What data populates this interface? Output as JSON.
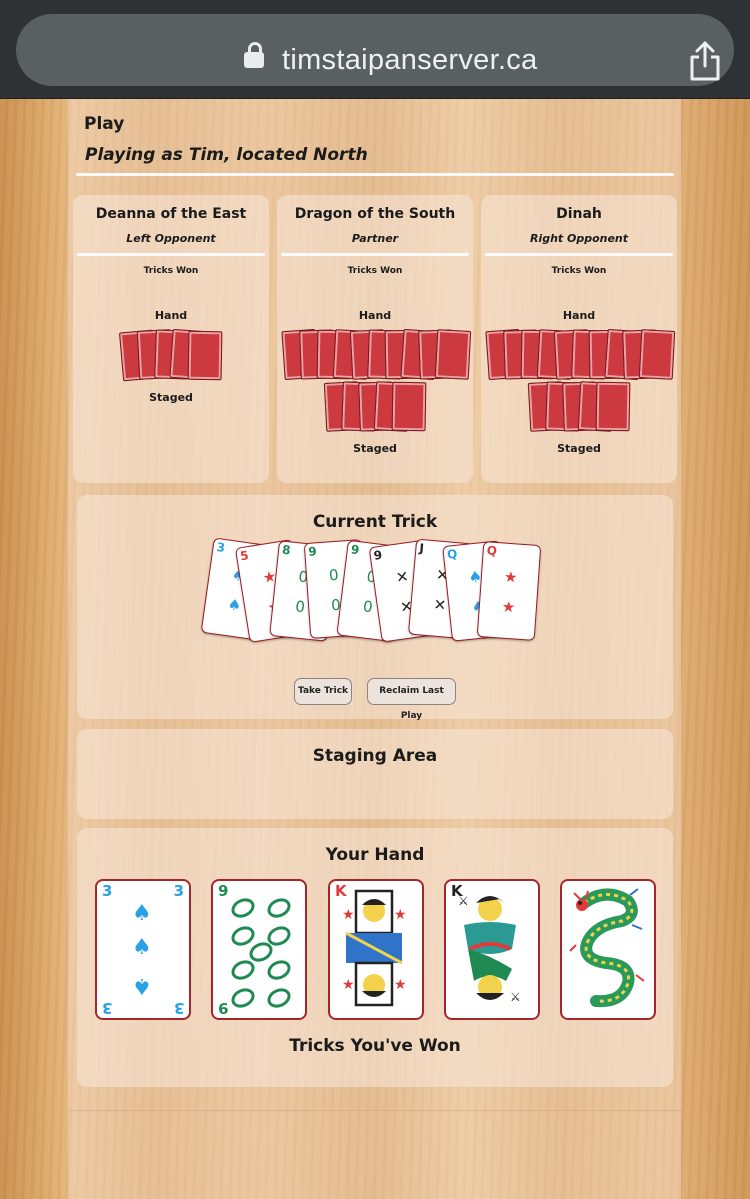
{
  "browser": {
    "url": "timstaipanserver.ca"
  },
  "play": {
    "title": "Play",
    "subtitle": "Playing as Tim, located North"
  },
  "labels": {
    "tricks_won": "Tricks Won",
    "hand": "Hand",
    "staged": "Staged"
  },
  "players": [
    {
      "name": "Deanna of the East",
      "role": "Left Opponent",
      "hand_count": 5,
      "staged_count": 0
    },
    {
      "name": "Dragon of the South",
      "role": "Partner",
      "hand_count": 14,
      "staged_count": 5
    },
    {
      "name": "Dinah",
      "role": "Right Opponent",
      "hand_count": 14,
      "staged_count": 5
    }
  ],
  "current_trick": {
    "title": "Current Trick",
    "cards": [
      {
        "rank": "3",
        "suit": "blue-pagoda"
      },
      {
        "rank": "5",
        "suit": "red-star"
      },
      {
        "rank": "8",
        "suit": "green-jade"
      },
      {
        "rank": "9",
        "suit": "green-jade"
      },
      {
        "rank": "9",
        "suit": "green-jade"
      },
      {
        "rank": "9",
        "suit": "black-sword"
      },
      {
        "rank": "J",
        "suit": "black-sword"
      },
      {
        "rank": "Q",
        "suit": "blue-pagoda"
      },
      {
        "rank": "Q",
        "suit": "red-star"
      }
    ],
    "take_trick_label": "Take Trick",
    "reclaim_label": "Reclaim Last Play"
  },
  "staging_area": {
    "title": "Staging Area"
  },
  "your_hand": {
    "title": "Your Hand",
    "cards": [
      {
        "rank": "3",
        "suit": "blue-pagoda"
      },
      {
        "rank": "9",
        "suit": "green-jade"
      },
      {
        "rank": "K",
        "suit": "red-star"
      },
      {
        "rank": "K",
        "suit": "black-sword"
      },
      {
        "rank": "",
        "suit": "dragon"
      }
    ]
  },
  "tricks_you_won": {
    "title": "Tricks You've Won"
  },
  "colors": {
    "card_back": "#cc3a40",
    "card_border": "#a4262c",
    "pagoda": "#2aa0e6",
    "jade": "#1e8a52",
    "star": "#e23a3a",
    "sword": "#222222"
  }
}
